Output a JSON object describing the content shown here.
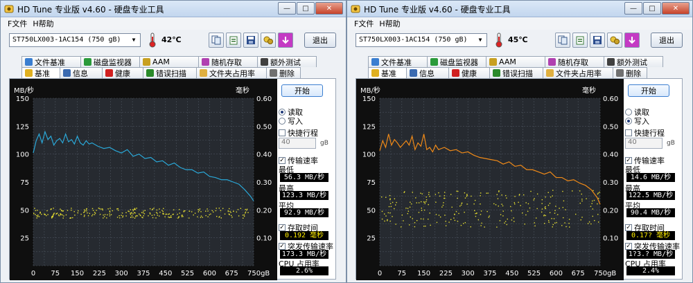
{
  "windows": [
    {
      "title": "HD Tune 专业版 v4.60 - 硬盘专业工具",
      "menu": [
        "F文件",
        "H帮助"
      ],
      "drive": "ST750LX003-1AC154 (750 gB)",
      "temperature": "42℃",
      "exit_label": "退出",
      "tabs_row1": [
        "文件基准",
        "磁盘监视器",
        "AAM",
        "随机存取",
        "额外测试"
      ],
      "tabs_row2": [
        "基准",
        "信息",
        "健康",
        "错误扫描",
        "文件夹占用率",
        "删除"
      ],
      "start_label": "开始",
      "read_label": "读取",
      "write_label": "写入",
      "mode_selected": "read",
      "quick_label": "快捷行程",
      "quick_checked": false,
      "quick_value": "40",
      "quick_unit": "gB",
      "transfer_label": "传输速率",
      "transfer_checked": true,
      "min_label": "最低",
      "min_value": "56.3 MB/秒",
      "max_label": "最高",
      "max_value": "123.3 MB/秒",
      "avg_label": "平均",
      "avg_value": "92.9 MB/秒",
      "access_label": "存取时间",
      "access_checked": true,
      "access_value": "0.192 毫秒",
      "burst_label": "突发传输速率",
      "burst_checked": true,
      "burst_value": "173.3 MB/秒",
      "cpu_label": "CPU 占用率",
      "cpu_value": "2.6%",
      "line_color": "#2aa8d8"
    },
    {
      "title": "HD Tune 专业版 v4.60 - 硬盘专业工具",
      "menu": [
        "F文件",
        "H帮助"
      ],
      "drive": "ST750LX003-1AC154 (750 gB)",
      "temperature": "45℃",
      "exit_label": "退出",
      "tabs_row1": [
        "文件基准",
        "磁盘监视器",
        "AAM",
        "随机存取",
        "额外测试"
      ],
      "tabs_row2": [
        "基准",
        "信息",
        "健康",
        "错误扫描",
        "文件夹占用率",
        "删除"
      ],
      "start_label": "开始",
      "read_label": "读取",
      "write_label": "写入",
      "mode_selected": "write",
      "quick_label": "快捷行程",
      "quick_checked": false,
      "quick_value": "40",
      "quick_unit": "gB",
      "transfer_label": "传输速率",
      "transfer_checked": true,
      "min_label": "最低",
      "min_value": "14.6 MB/秒",
      "max_label": "最高",
      "max_value": "122.5 MB/秒",
      "avg_label": "平均",
      "avg_value": "90.4 MB/秒",
      "access_label": "存取时间",
      "access_checked": true,
      "access_value": "0.17? 毫秒",
      "burst_label": "突发传输速率",
      "burst_checked": true,
      "burst_value": "1?3.? MB/秒",
      "cpu_label": "CPU 占用率",
      "cpu_value": "2.4%",
      "line_color": "#f08a18"
    }
  ],
  "chart_data": [
    {
      "type": "line",
      "ylabel": "MB/秒",
      "y2label": "毫秒",
      "ylim": [
        0,
        150
      ],
      "y2lim": [
        0,
        0.6
      ],
      "y_ticks": [
        "150",
        "125",
        "100",
        "75",
        "50",
        "25"
      ],
      "y2_ticks": [
        "0.60",
        "0.50",
        "0.40",
        "0.30",
        "0.20",
        "0.10"
      ],
      "x_ticks": [
        "0",
        "75",
        "150",
        "225",
        "300",
        "375",
        "450",
        "525",
        "600",
        "675",
        "750gB"
      ],
      "xlim": [
        0,
        750
      ],
      "series": [
        {
          "x": [
            0,
            10,
            20,
            30,
            40,
            50,
            60,
            70,
            80,
            90,
            100,
            110,
            120,
            130,
            140,
            150,
            160,
            170,
            180,
            190,
            200,
            220,
            240,
            260,
            280,
            300,
            320,
            340,
            360,
            380,
            400,
            420,
            440,
            460,
            480,
            500,
            520,
            540,
            560,
            580,
            600,
            620,
            640,
            660,
            680,
            700,
            720,
            740,
            750
          ],
          "values": [
            101,
            112,
            118,
            110,
            120,
            113,
            116,
            108,
            112,
            114,
            110,
            118,
            111,
            113,
            109,
            116,
            110,
            108,
            112,
            109,
            110,
            107,
            105,
            106,
            103,
            101,
            104,
            98,
            100,
            96,
            97,
            93,
            94,
            90,
            92,
            88,
            86,
            86,
            83,
            84,
            80,
            79,
            77,
            77,
            75,
            73,
            68,
            62,
            58
          ]
        }
      ],
      "access_time_scatter_band": [
        43,
        52
      ]
    },
    {
      "type": "line",
      "ylabel": "MB/秒",
      "y2label": "毫秒",
      "ylim": [
        0,
        150
      ],
      "y2lim": [
        0,
        0.6
      ],
      "y_ticks": [
        "150",
        "125",
        "100",
        "75",
        "50",
        "25"
      ],
      "y2_ticks": [
        "0.60",
        "0.50",
        "0.40",
        "0.30",
        "0.20",
        "0.10"
      ],
      "x_ticks": [
        "0",
        "75",
        "150",
        "225",
        "300",
        "375",
        "450",
        "525",
        "600",
        "675",
        "750gB"
      ],
      "xlim": [
        0,
        750
      ],
      "series": [
        {
          "x": [
            0,
            10,
            20,
            30,
            40,
            50,
            60,
            70,
            80,
            90,
            100,
            110,
            120,
            130,
            140,
            150,
            160,
            170,
            180,
            190,
            200,
            220,
            240,
            260,
            280,
            300,
            320,
            340,
            360,
            380,
            400,
            420,
            440,
            460,
            480,
            500,
            520,
            540,
            560,
            580,
            600,
            620,
            640,
            660,
            680,
            700,
            720,
            740,
            750
          ],
          "values": [
            103,
            112,
            106,
            118,
            108,
            113,
            110,
            106,
            109,
            112,
            108,
            116,
            104,
            110,
            107,
            118,
            104,
            106,
            102,
            108,
            104,
            106,
            103,
            104,
            101,
            102,
            99,
            97,
            96,
            95,
            94,
            91,
            93,
            89,
            90,
            86,
            86,
            84,
            82,
            84,
            79,
            79,
            76,
            77,
            74,
            72,
            68,
            61,
            55
          ]
        }
      ],
      "access_time_scatter_band": [
        35,
        68
      ]
    }
  ]
}
